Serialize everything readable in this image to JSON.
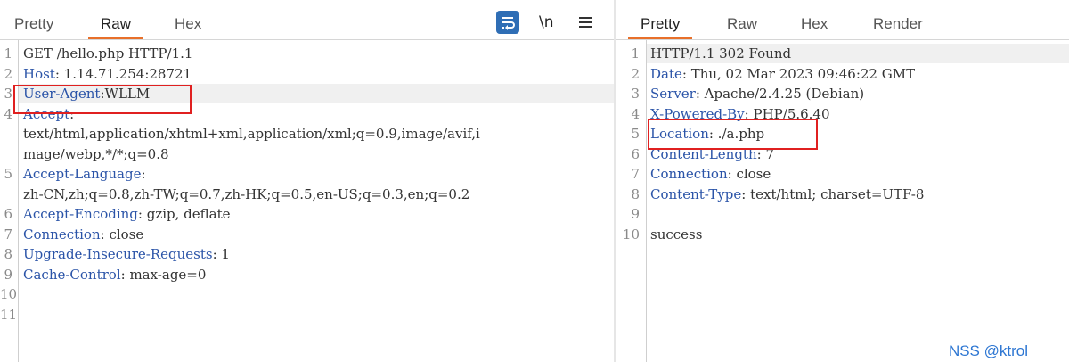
{
  "request": {
    "tabs": [
      {
        "label": "Pretty",
        "active": false
      },
      {
        "label": "Raw",
        "active": true
      },
      {
        "label": "Hex",
        "active": false
      }
    ],
    "toolbar": {
      "wrap_icon": "wrap-lines-icon",
      "newline_label": "\\n",
      "menu_icon": "hamburger-menu-icon",
      "accent_color": "#2f6eb5"
    },
    "lines": [
      {
        "num": "1",
        "name": "",
        "value": "GET /hello.php HTTP/1.1"
      },
      {
        "num": "2",
        "name": "Host",
        "value": ": 1.14.71.254:28721"
      },
      {
        "num": "3",
        "name": "User-Agent",
        "value": ":WLLM",
        "highlighted": true
      },
      {
        "num": "4",
        "name": "Accept",
        "value": ":"
      },
      {
        "num": "",
        "name": "",
        "value": "text/html,application/xhtml+xml,application/xml;q=0.9,image/avif,i"
      },
      {
        "num": "",
        "name": "",
        "value": "mage/webp,*/*;q=0.8"
      },
      {
        "num": "5",
        "name": "Accept-Language",
        "value": ":"
      },
      {
        "num": "",
        "name": "",
        "value": "zh-CN,zh;q=0.8,zh-TW;q=0.7,zh-HK;q=0.5,en-US;q=0.3,en;q=0.2"
      },
      {
        "num": "6",
        "name": "Accept-Encoding",
        "value": ": gzip, deflate"
      },
      {
        "num": "7",
        "name": "Connection",
        "value": ": close"
      },
      {
        "num": "8",
        "name": "Upgrade-Insecure-Requests",
        "value": ": 1"
      },
      {
        "num": "9",
        "name": "Cache-Control",
        "value": ": max-age=0"
      },
      {
        "num": "10",
        "name": "",
        "value": ""
      },
      {
        "num": "11",
        "name": "",
        "value": ""
      }
    ]
  },
  "response": {
    "tabs": [
      {
        "label": "Pretty",
        "active": true
      },
      {
        "label": "Raw",
        "active": false
      },
      {
        "label": "Hex",
        "active": false
      },
      {
        "label": "Render",
        "active": false
      }
    ],
    "lines": [
      {
        "num": "1",
        "name": "",
        "value": "HTTP/1.1 302 Found",
        "highlighted": true
      },
      {
        "num": "2",
        "name": "Date",
        "value": ": Thu, 02 Mar 2023 09:46:22 GMT"
      },
      {
        "num": "3",
        "name": "Server",
        "value": ": Apache/2.4.25 (Debian)"
      },
      {
        "num": "4",
        "name": "X-Powered-By",
        "value": ": PHP/5.6.40"
      },
      {
        "num": "5",
        "name": "Location",
        "value": ": ./a.php"
      },
      {
        "num": "6",
        "name": "Content-Length",
        "value": ": 7"
      },
      {
        "num": "7",
        "name": "Connection",
        "value": ": close"
      },
      {
        "num": "8",
        "name": "Content-Type",
        "value": ": text/html; charset=UTF-8"
      },
      {
        "num": "9",
        "name": "",
        "value": ""
      },
      {
        "num": "10",
        "name": "",
        "value": "success"
      }
    ]
  },
  "watermark": "NSS @ktrol",
  "colors": {
    "header_name": "#2b54a8",
    "tab_underline": "#e8702a",
    "annotation_box": "#e02020",
    "watermark": "#2d76d2"
  }
}
